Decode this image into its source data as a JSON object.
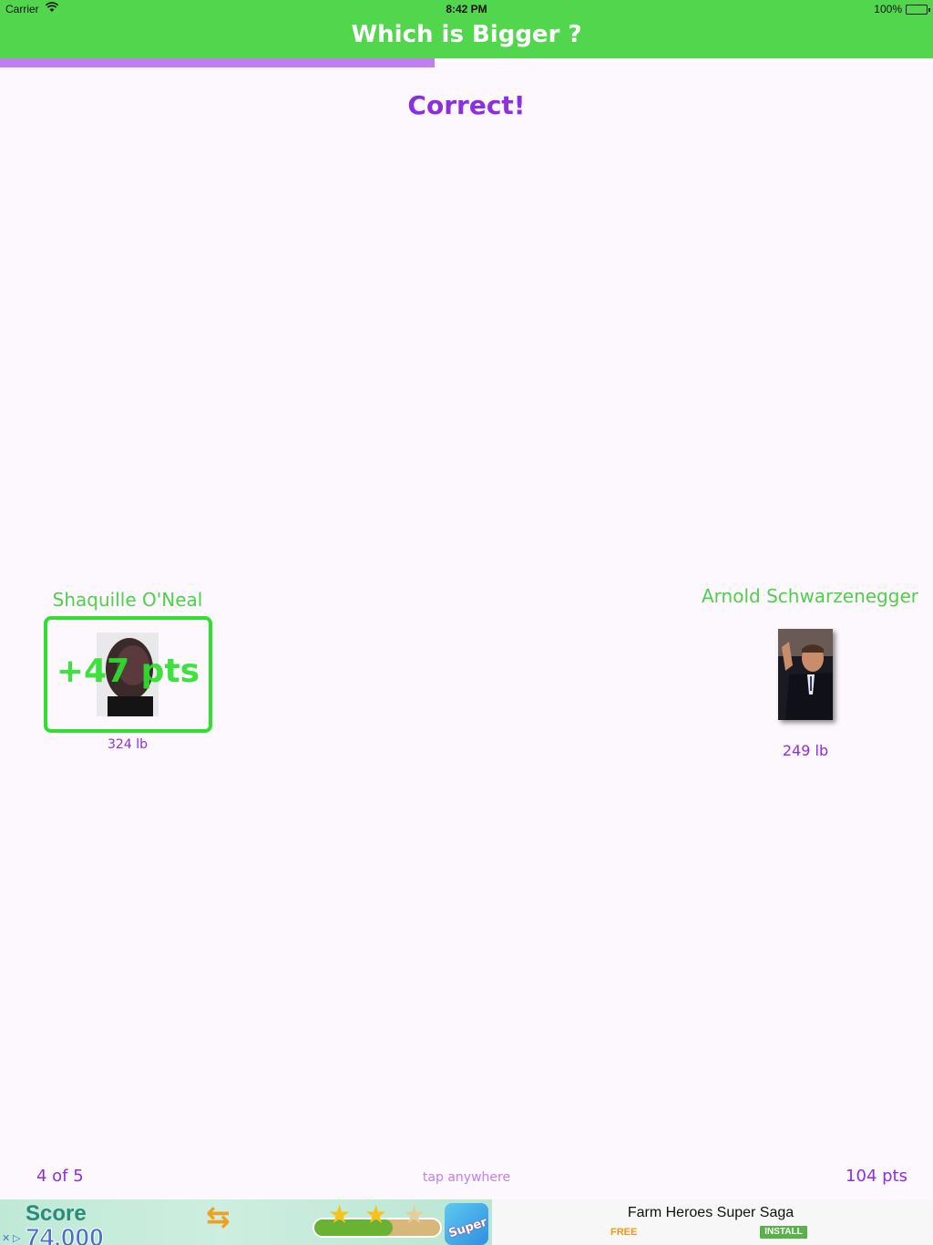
{
  "status_bar": {
    "carrier": "Carrier",
    "time": "8:42 PM",
    "battery_percent": "100%",
    "wifi_icon": "wifi-icon",
    "battery_icon": "battery-icon"
  },
  "nav": {
    "title": "Which is Bigger ?"
  },
  "progress": {
    "fraction": 0.466,
    "color": "#c17ef0"
  },
  "result": {
    "text": "Correct!"
  },
  "left": {
    "name": "Shaquille O'Neal",
    "points": "+47 pts",
    "weight": "324 lb"
  },
  "right": {
    "name": "Arnold Schwarzenegger",
    "weight": "249 lb"
  },
  "footer": {
    "question": "4 of 5",
    "hint": "tap anywhere",
    "score": "104 pts"
  },
  "ad": {
    "score_label": "Score",
    "score_value": "74,000",
    "title": "Farm Heroes Super Saga",
    "price": "FREE",
    "install_label": "INSTALL",
    "icon_text": "Super"
  },
  "colors": {
    "header_green": "#52d64e",
    "accent_purple": "#8d2ee0",
    "highlight_green": "#2fe02f",
    "background": "#fdf8fd"
  }
}
